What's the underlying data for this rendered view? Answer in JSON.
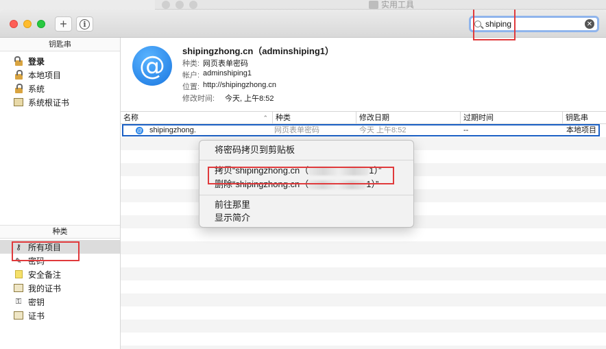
{
  "background_window": {
    "title": "实用工具"
  },
  "toolbar": {
    "add_label": "+",
    "info_label": "i"
  },
  "search": {
    "value": "shiping"
  },
  "sidebar": {
    "keychains_header": "钥匙串",
    "keychains": [
      {
        "label": "登录",
        "icon": "lock-open-icon"
      },
      {
        "label": "本地项目",
        "icon": "lock-icon"
      },
      {
        "label": "系统",
        "icon": "lock-icon"
      },
      {
        "label": "系统根证书",
        "icon": "certificate-cabinet-icon"
      }
    ],
    "categories_header": "种类",
    "categories": [
      {
        "label": "所有项目",
        "icon": "keys-icon"
      },
      {
        "label": "密码",
        "icon": "pencil-icon"
      },
      {
        "label": "安全备注",
        "icon": "note-icon"
      },
      {
        "label": "我的证书",
        "icon": "certificate-icon"
      },
      {
        "label": "密钥",
        "icon": "key-icon"
      },
      {
        "label": "证书",
        "icon": "certificate-icon"
      }
    ]
  },
  "detail": {
    "title": "shipingzhong.cn（adminshiping1）",
    "kind_label": "种类:",
    "kind_value": "网页表单密码",
    "account_label": "帐户:",
    "account_value": "adminshiping1",
    "where_label": "位置:",
    "where_value": "http://shipingzhong.cn",
    "modified_label": "修改时间:",
    "modified_value": "今天, 上午8:52"
  },
  "table": {
    "columns": [
      "名称",
      "种类",
      "修改日期",
      "过期时间",
      "钥匙串"
    ],
    "row": {
      "name": "shipingzhong.",
      "kind": "网页表单密码",
      "modified": "今天 上午8:52",
      "expires": "--",
      "keychain": "本地项目"
    }
  },
  "context_menu": {
    "copy_password": "将密码拷贝到剪贴板",
    "copy_item_prefix": "拷贝“shipingzhong.cn（",
    "copy_item_suffix": "1）”",
    "delete_item_prefix": "删除“shipingzhong.cn（",
    "delete_item_suffix": "1）”",
    "go_there": "前往那里",
    "get_info": "显示简介"
  },
  "colors": {
    "highlight_red": "#e0393b",
    "selection_blue": "#1a5fc4",
    "accent": "#2a86ea"
  }
}
